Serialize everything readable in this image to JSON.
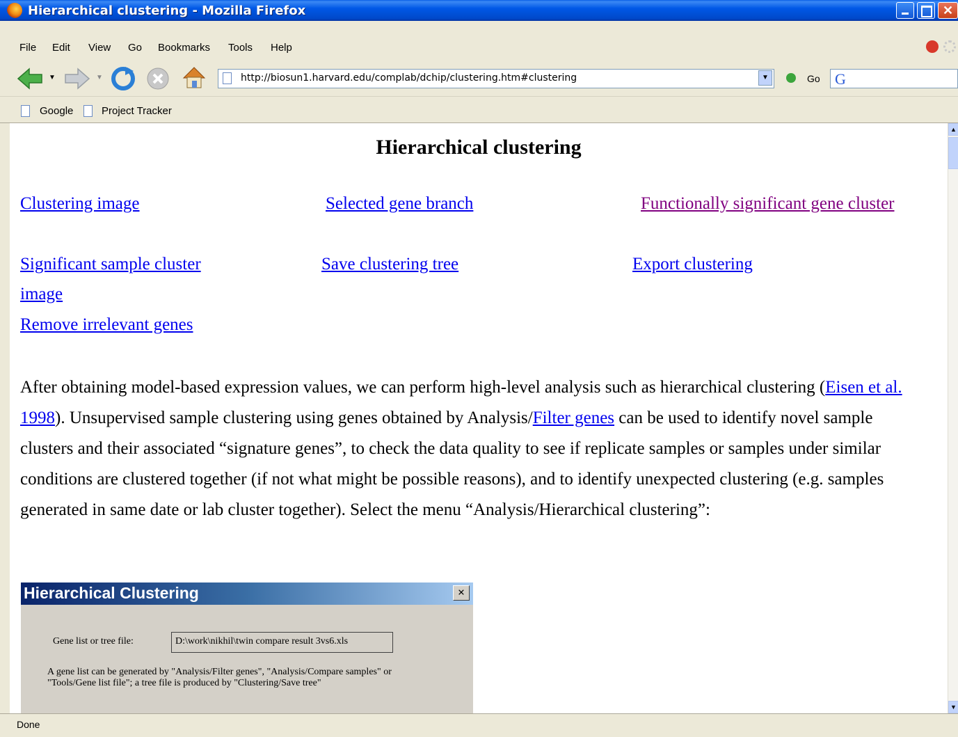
{
  "window": {
    "title": "Hierarchical clustering - Mozilla Firefox"
  },
  "menu": {
    "items": [
      "File",
      "Edit",
      "View",
      "Go",
      "Bookmarks",
      "Tools",
      "Help"
    ]
  },
  "navigation": {
    "url": "http://biosun1.harvard.edu/complab/dchip/clustering.htm#clustering",
    "go_label": "Go"
  },
  "bookmarks": {
    "items": [
      "Google",
      "Project Tracker"
    ]
  },
  "page": {
    "heading": "Hierarchical clustering",
    "links": {
      "clustering_image": "Clustering image",
      "selected_gene_branch": "Selected gene branch",
      "functionally_significant": "Functionally significant gene cluster",
      "significant_sample_cluster_line1": "Significant sample cluster",
      "significant_sample_cluster_line2": "image",
      "save_clustering_tree": "Save clustering tree",
      "export_clustering": "Export clustering",
      "remove_irrelevant_genes": "Remove irrelevant genes"
    },
    "paragraph": {
      "part1": "After obtaining model-based expression values, we can perform high-level analysis such as hierarchical clustering (",
      "link1": "Eisen et al. 1998",
      "part2": "). Unsupervised sample clustering using genes obtained by Analysis/",
      "link2": "Filter genes",
      "part3": " can be used to identify novel sample clusters and their associated “signature genes”, to check the data quality to see if replicate samples or samples under similar conditions are clustered together (if not what might be possible reasons), and to identify unexpected clustering (e.g. samples generated in same date or lab cluster together). Select the menu “Analysis/Hierarchical clustering”:"
    },
    "dialog": {
      "title": "Hierarchical Clustering",
      "close_label": "×",
      "gene_list_label": "Gene list or tree file:",
      "gene_list_value": "D:\\work\\nikhil\\twin compare result 3vs6.xls",
      "note": "A gene list can be generated by \"Analysis/Filter genes\", \"Analysis/Compare samples\" or \"Tools/Gene list file\"; a tree file is produced by \"Clustering/Save tree\""
    }
  },
  "status": {
    "text": "Done"
  },
  "colors": {
    "link": "#0000ee",
    "visited_link": "#800080",
    "titlebar": "#0058e6"
  }
}
